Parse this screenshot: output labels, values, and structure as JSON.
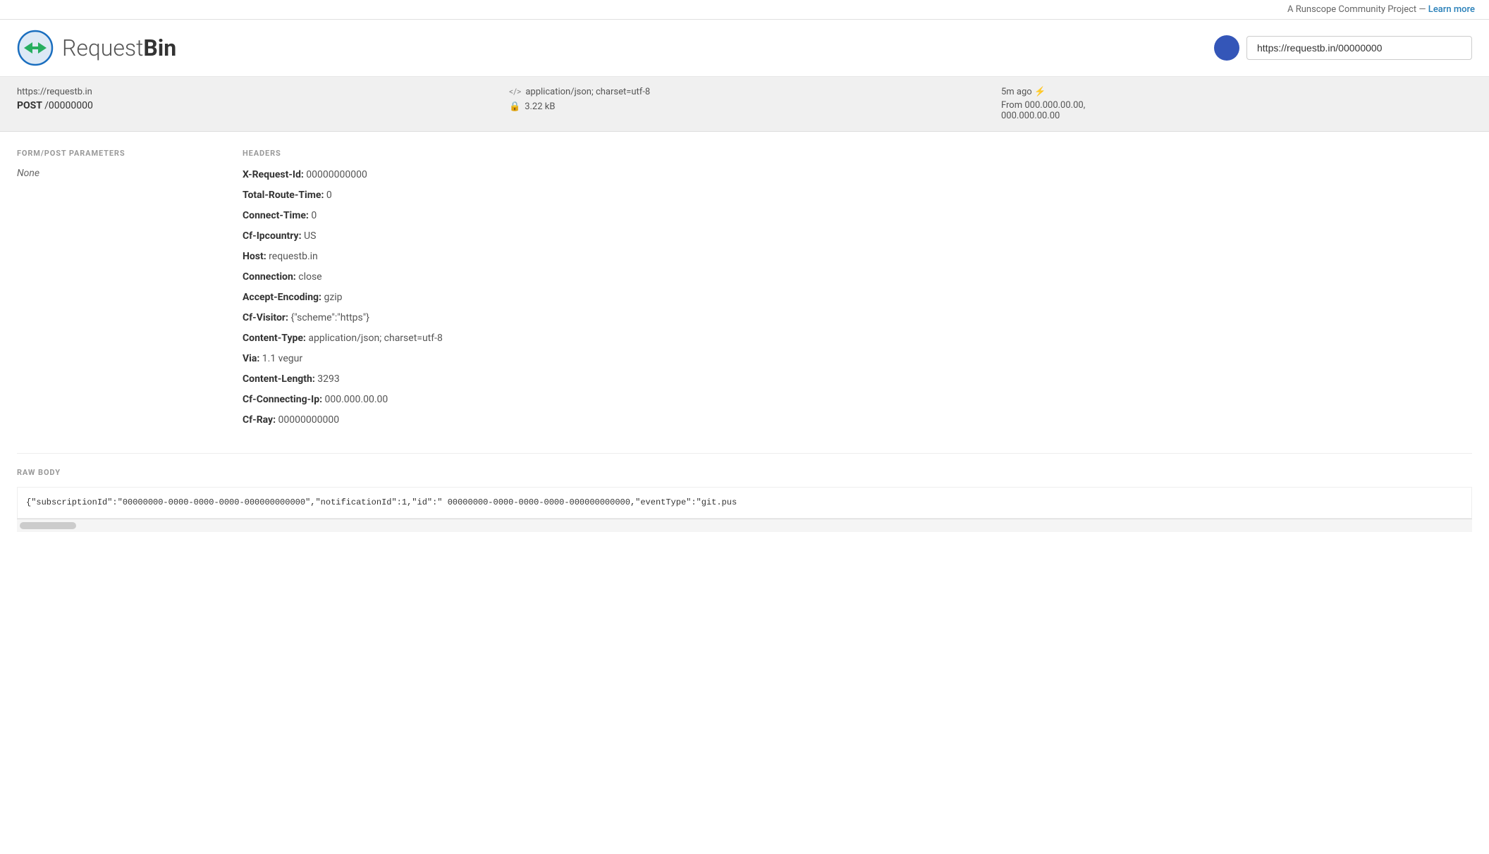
{
  "top_banner": {
    "text": "A Runscope Community Project — ",
    "link_label": "Learn more",
    "link_url": "#"
  },
  "header": {
    "logo_text_light": "Request",
    "logo_text_bold": "Bin",
    "url_bar_value": "https://requestb.in/00000000"
  },
  "request_info": {
    "url": "https://requestb.in",
    "method": "POST",
    "path": "/00000000",
    "content_type_icon": "</>",
    "content_type": "application/json; charset=utf-8",
    "size_icon": "🔒",
    "size": "3.22 kB",
    "time_ago": "5m ago",
    "time_link": "⚡",
    "from_label": "From",
    "from_ip1": "000.000.00.00,",
    "from_ip2": "000.000.00.00"
  },
  "form_post": {
    "title": "FORM/POST PARAMETERS",
    "value": "None"
  },
  "headers": {
    "title": "HEADERS",
    "items": [
      {
        "key": "X-Request-Id:",
        "value": "00000000000"
      },
      {
        "key": "Total-Route-Time:",
        "value": "0"
      },
      {
        "key": "Connect-Time:",
        "value": "0"
      },
      {
        "key": "Cf-Ipcountry:",
        "value": "US"
      },
      {
        "key": "Host:",
        "value": "requestb.in"
      },
      {
        "key": "Connection:",
        "value": "close"
      },
      {
        "key": "Accept-Encoding:",
        "value": "gzip"
      },
      {
        "key": "Cf-Visitor:",
        "value": "{\"scheme\":\"https\"}"
      },
      {
        "key": "Content-Type:",
        "value": "application/json; charset=utf-8"
      },
      {
        "key": "Via:",
        "value": "1.1 vegur"
      },
      {
        "key": "Content-Length:",
        "value": "3293"
      },
      {
        "key": "Cf-Connecting-Ip:",
        "value": "000.000.00.00"
      },
      {
        "key": "Cf-Ray:",
        "value": "00000000000"
      }
    ]
  },
  "raw_body": {
    "title": "RAW BODY",
    "content": "{\"subscriptionId\":\"00000000-0000-0000-0000-000000000000\",\"notificationId\":1,\"id\":\" 00000000-0000-0000-0000-000000000000,\"eventType\":\"git.pus"
  }
}
